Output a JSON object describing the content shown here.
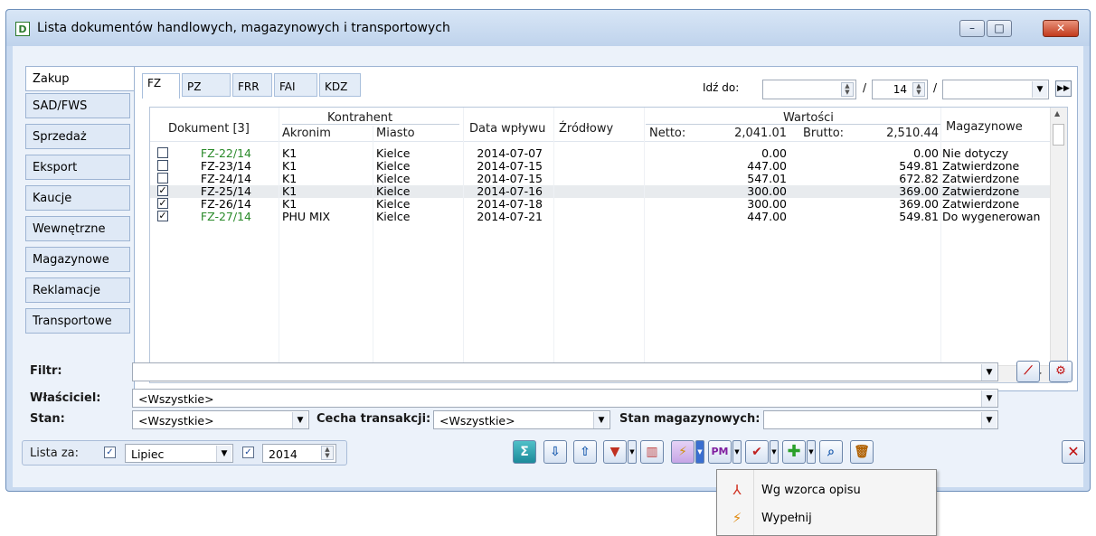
{
  "window": {
    "title": "Lista dokumentów handlowych, magazynowych i transportowych",
    "title_icon": "D",
    "controls": {
      "minimize": "–",
      "maximize": "□",
      "close": "✕"
    }
  },
  "left_tabs": [
    "Zakup",
    "SAD/FWS",
    "Sprzedaż",
    "Eksport",
    "Kaucje",
    "Wewnętrzne",
    "Magazynowe",
    "Reklamacje",
    "Transportowe"
  ],
  "top_tabs": [
    "FZ",
    "PZ",
    "FRR",
    "FAI",
    "KDZ"
  ],
  "goto": {
    "label": "Idź do:",
    "value1": "",
    "slash": "/",
    "value2": "14",
    "value3": ""
  },
  "grid": {
    "headers": {
      "dokument": "Dokument [3]",
      "kontrahent": "Kontrahent",
      "akronim": "Akronim",
      "miasto": "Miasto",
      "data_wplywu": "Data wpływu",
      "zrodlowy": "Źródłowy",
      "wartosci": "Wartości",
      "netto_label": "Netto:",
      "netto_total": "2,041.01",
      "brutto_label": "Brutto:",
      "brutto_total": "2,510.44",
      "magazynowe": "Magazynowe"
    },
    "rows": [
      {
        "checked": false,
        "doc": "FZ-22/14",
        "green": true,
        "akronim": "K1",
        "miasto": "Kielce",
        "data": "2014-07-07",
        "netto": "0.00",
        "brutto": "0.00",
        "mag": "Nie dotyczy"
      },
      {
        "checked": false,
        "doc": "FZ-23/14",
        "green": false,
        "akronim": "K1",
        "miasto": "Kielce",
        "data": "2014-07-15",
        "netto": "447.00",
        "brutto": "549.81",
        "mag": "Zatwierdzone"
      },
      {
        "checked": false,
        "doc": "FZ-24/14",
        "green": false,
        "akronim": "K1",
        "miasto": "Kielce",
        "data": "2014-07-15",
        "netto": "547.01",
        "brutto": "672.82",
        "mag": "Zatwierdzone"
      },
      {
        "checked": true,
        "doc": "FZ-25/14",
        "green": false,
        "akronim": "K1",
        "miasto": "Kielce",
        "data": "2014-07-16",
        "netto": "300.00",
        "brutto": "369.00",
        "mag": "Zatwierdzone"
      },
      {
        "checked": true,
        "doc": "FZ-26/14",
        "green": false,
        "akronim": "K1",
        "miasto": "Kielce",
        "data": "2014-07-18",
        "netto": "300.00",
        "brutto": "369.00",
        "mag": "Zatwierdzone"
      },
      {
        "checked": true,
        "doc": "FZ-27/14",
        "green": true,
        "akronim": "PHU MIX",
        "miasto": "Kielce",
        "data": "2014-07-21",
        "netto": "447.00",
        "brutto": "549.81",
        "mag": "Do wygenerowan"
      }
    ]
  },
  "filters": {
    "filtr_label": "Filtr:",
    "filtr_value": "",
    "wlasciciel_label": "Właściciel:",
    "wlasciciel_value": "<Wszystkie>",
    "stan_label": "Stan:",
    "stan_value": "<Wszystkie>",
    "cecha_label": "Cecha transakcji:",
    "cecha_value": "<Wszystkie>",
    "stan_mag_label": "Stan magazynowych:",
    "stan_mag_value": ""
  },
  "lista_za": {
    "label": "Lista za:",
    "month": "Lipiec",
    "year": "2014"
  },
  "toolbar_icons": [
    "sum-icon",
    "export-icon",
    "share-icon",
    "print-icon",
    "columns-icon",
    "generate-icon",
    "pm-icon",
    "approve-icon",
    "add-icon",
    "search-icon",
    "delete-icon",
    "close-icon"
  ],
  "pm_label": "PM",
  "dropdown_menu": {
    "items": [
      {
        "label": "Wg wzorca opisu",
        "icon": "pattern-icon"
      },
      {
        "label": "Wypełnij",
        "icon": "lightning-icon"
      }
    ]
  }
}
